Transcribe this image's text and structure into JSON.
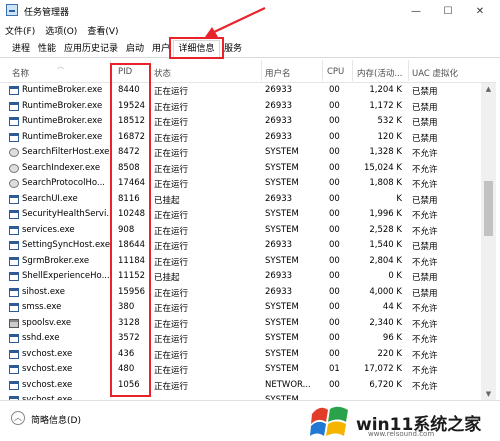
{
  "window": {
    "title": "任务管理器",
    "controls": {
      "minimize": "—",
      "maximize": "☐",
      "close": "✕"
    }
  },
  "menu": [
    "文件(F)",
    "选项(O)",
    "查看(V)"
  ],
  "tabs": [
    "进程",
    "性能",
    "应用历史记录",
    "启动",
    "用户",
    "详细信息",
    "服务"
  ],
  "active_tab": "详细信息",
  "columns": {
    "name": "名称",
    "pid": "PID",
    "status": "状态",
    "user": "用户名",
    "cpu": "CPU",
    "memory": "内存(活动...",
    "uac": "UAC 虚拟化"
  },
  "rows": [
    {
      "icon": "window",
      "name": "RuntimeBroker.exe",
      "pid": "8440",
      "status": "正在运行",
      "user": "26933",
      "cpu": "00",
      "mem": "1,204 K",
      "uac": "已禁用"
    },
    {
      "icon": "window",
      "name": "RuntimeBroker.exe",
      "pid": "19524",
      "status": "正在运行",
      "user": "26933",
      "cpu": "00",
      "mem": "1,172 K",
      "uac": "已禁用"
    },
    {
      "icon": "window",
      "name": "RuntimeBroker.exe",
      "pid": "18512",
      "status": "正在运行",
      "user": "26933",
      "cpu": "00",
      "mem": "532 K",
      "uac": "已禁用"
    },
    {
      "icon": "window",
      "name": "RuntimeBroker.exe",
      "pid": "16872",
      "status": "正在运行",
      "user": "26933",
      "cpu": "00",
      "mem": "120 K",
      "uac": "已禁用"
    },
    {
      "icon": "gear",
      "name": "SearchFilterHost.exe",
      "pid": "8472",
      "status": "正在运行",
      "user": "SYSTEM",
      "cpu": "00",
      "mem": "1,328 K",
      "uac": "不允许"
    },
    {
      "icon": "gear",
      "name": "SearchIndexer.exe",
      "pid": "8508",
      "status": "正在运行",
      "user": "SYSTEM",
      "cpu": "00",
      "mem": "15,024 K",
      "uac": "不允许"
    },
    {
      "icon": "gear",
      "name": "SearchProtocolHo...",
      "pid": "17464",
      "status": "正在运行",
      "user": "SYSTEM",
      "cpu": "00",
      "mem": "1,808 K",
      "uac": "不允许"
    },
    {
      "icon": "window",
      "name": "SearchUI.exe",
      "pid": "8116",
      "status": "已挂起",
      "user": "26933",
      "cpu": "00",
      "mem": "K",
      "uac": "已禁用"
    },
    {
      "icon": "window",
      "name": "SecurityHealthServi...",
      "pid": "10248",
      "status": "正在运行",
      "user": "SYSTEM",
      "cpu": "00",
      "mem": "1,996 K",
      "uac": "不允许"
    },
    {
      "icon": "window",
      "name": "services.exe",
      "pid": "908",
      "status": "正在运行",
      "user": "SYSTEM",
      "cpu": "00",
      "mem": "2,528 K",
      "uac": "不允许"
    },
    {
      "icon": "window",
      "name": "SettingSyncHost.exe",
      "pid": "18644",
      "status": "正在运行",
      "user": "26933",
      "cpu": "00",
      "mem": "1,540 K",
      "uac": "已禁用"
    },
    {
      "icon": "window",
      "name": "SgrmBroker.exe",
      "pid": "11184",
      "status": "正在运行",
      "user": "SYSTEM",
      "cpu": "00",
      "mem": "2,804 K",
      "uac": "不允许"
    },
    {
      "icon": "window",
      "name": "ShellExperienceHo...",
      "pid": "11152",
      "status": "已挂起",
      "user": "26933",
      "cpu": "00",
      "mem": "0 K",
      "uac": "已禁用"
    },
    {
      "icon": "window",
      "name": "sihost.exe",
      "pid": "15956",
      "status": "正在运行",
      "user": "26933",
      "cpu": "00",
      "mem": "4,000 K",
      "uac": "已禁用"
    },
    {
      "icon": "window",
      "name": "smss.exe",
      "pid": "380",
      "status": "正在运行",
      "user": "SYSTEM",
      "cpu": "00",
      "mem": "44 K",
      "uac": "不允许"
    },
    {
      "icon": "printer",
      "name": "spoolsv.exe",
      "pid": "3128",
      "status": "正在运行",
      "user": "SYSTEM",
      "cpu": "00",
      "mem": "2,340 K",
      "uac": "不允许"
    },
    {
      "icon": "window",
      "name": "sshd.exe",
      "pid": "3572",
      "status": "正在运行",
      "user": "SYSTEM",
      "cpu": "00",
      "mem": "96 K",
      "uac": "不允许"
    },
    {
      "icon": "window",
      "name": "svchost.exe",
      "pid": "436",
      "status": "正在运行",
      "user": "SYSTEM",
      "cpu": "00",
      "mem": "220 K",
      "uac": "不允许"
    },
    {
      "icon": "window",
      "name": "svchost.exe",
      "pid": "480",
      "status": "正在运行",
      "user": "SYSTEM",
      "cpu": "01",
      "mem": "17,072 K",
      "uac": "不允许"
    },
    {
      "icon": "window",
      "name": "svchost.exe",
      "pid": "1056",
      "status": "正在运行",
      "user": "NETWOR...",
      "cpu": "00",
      "mem": "6,720 K",
      "uac": "不允许"
    },
    {
      "icon": "window",
      "name": "svchost.exe",
      "pid": "",
      "status": "",
      "user": "SYSTEM",
      "cpu": "",
      "mem": "",
      "uac": ""
    }
  ],
  "footer": {
    "label": "简略信息(D)"
  },
  "watermark": {
    "text": "win11系统之家",
    "url": "www.relsound.com"
  },
  "colors": {
    "highlight": "#e8232a",
    "icon_blue": "#2f5b94"
  },
  "icons": [
    "app-icon",
    "minimize-icon",
    "maximize-icon",
    "close-icon",
    "sort-up-icon",
    "window-process-icon",
    "gear-process-icon",
    "printer-process-icon",
    "collapse-icon",
    "scroll-up-icon",
    "scroll-down-icon",
    "windows-logo-icon"
  ]
}
